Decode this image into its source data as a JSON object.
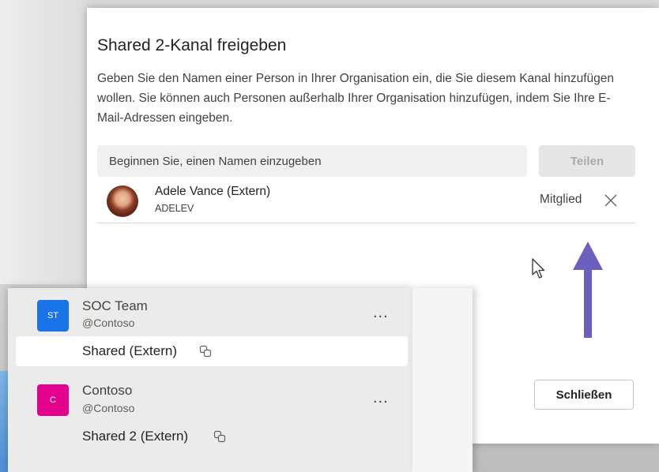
{
  "dialog": {
    "title": "Shared 2-Kanal freigeben",
    "description": "Geben Sie den Namen einer Person in Ihrer Organisation ein, die Sie diesem Kanal hinzufügen wollen. Sie können auch Personen außerhalb Ihrer Organisation hinzufügen, indem Sie Ihre E-Mail-Adressen eingeben.",
    "search_placeholder": "Beginnen Sie, einen Namen einzugeben",
    "share_label": "Teilen",
    "member": {
      "name": "Adele Vance (Extern)",
      "handle": "ADELEV",
      "role": "Mitglied"
    },
    "close_label": "Schließen"
  },
  "teams": [
    {
      "initials": "ST",
      "name": "SOC Team",
      "handle": "@Contoso",
      "color": "#1a73e8",
      "more": "...",
      "channel": "Shared (Extern)",
      "channel_selected": true
    },
    {
      "initials": "C",
      "name": "Contoso",
      "handle": "@Contoso",
      "color": "#e3008c",
      "more": "...",
      "channel": "Shared 2 (Extern)",
      "channel_selected": false
    }
  ],
  "colors": {
    "arrow": "#6b5fbf",
    "accent_blue": "#1a73e8",
    "accent_pink": "#e3008c"
  },
  "icons": [
    "remove-icon",
    "shared-channel-icon",
    "more-options-icon",
    "arrow-up-icon",
    "mouse-cursor-icon"
  ]
}
